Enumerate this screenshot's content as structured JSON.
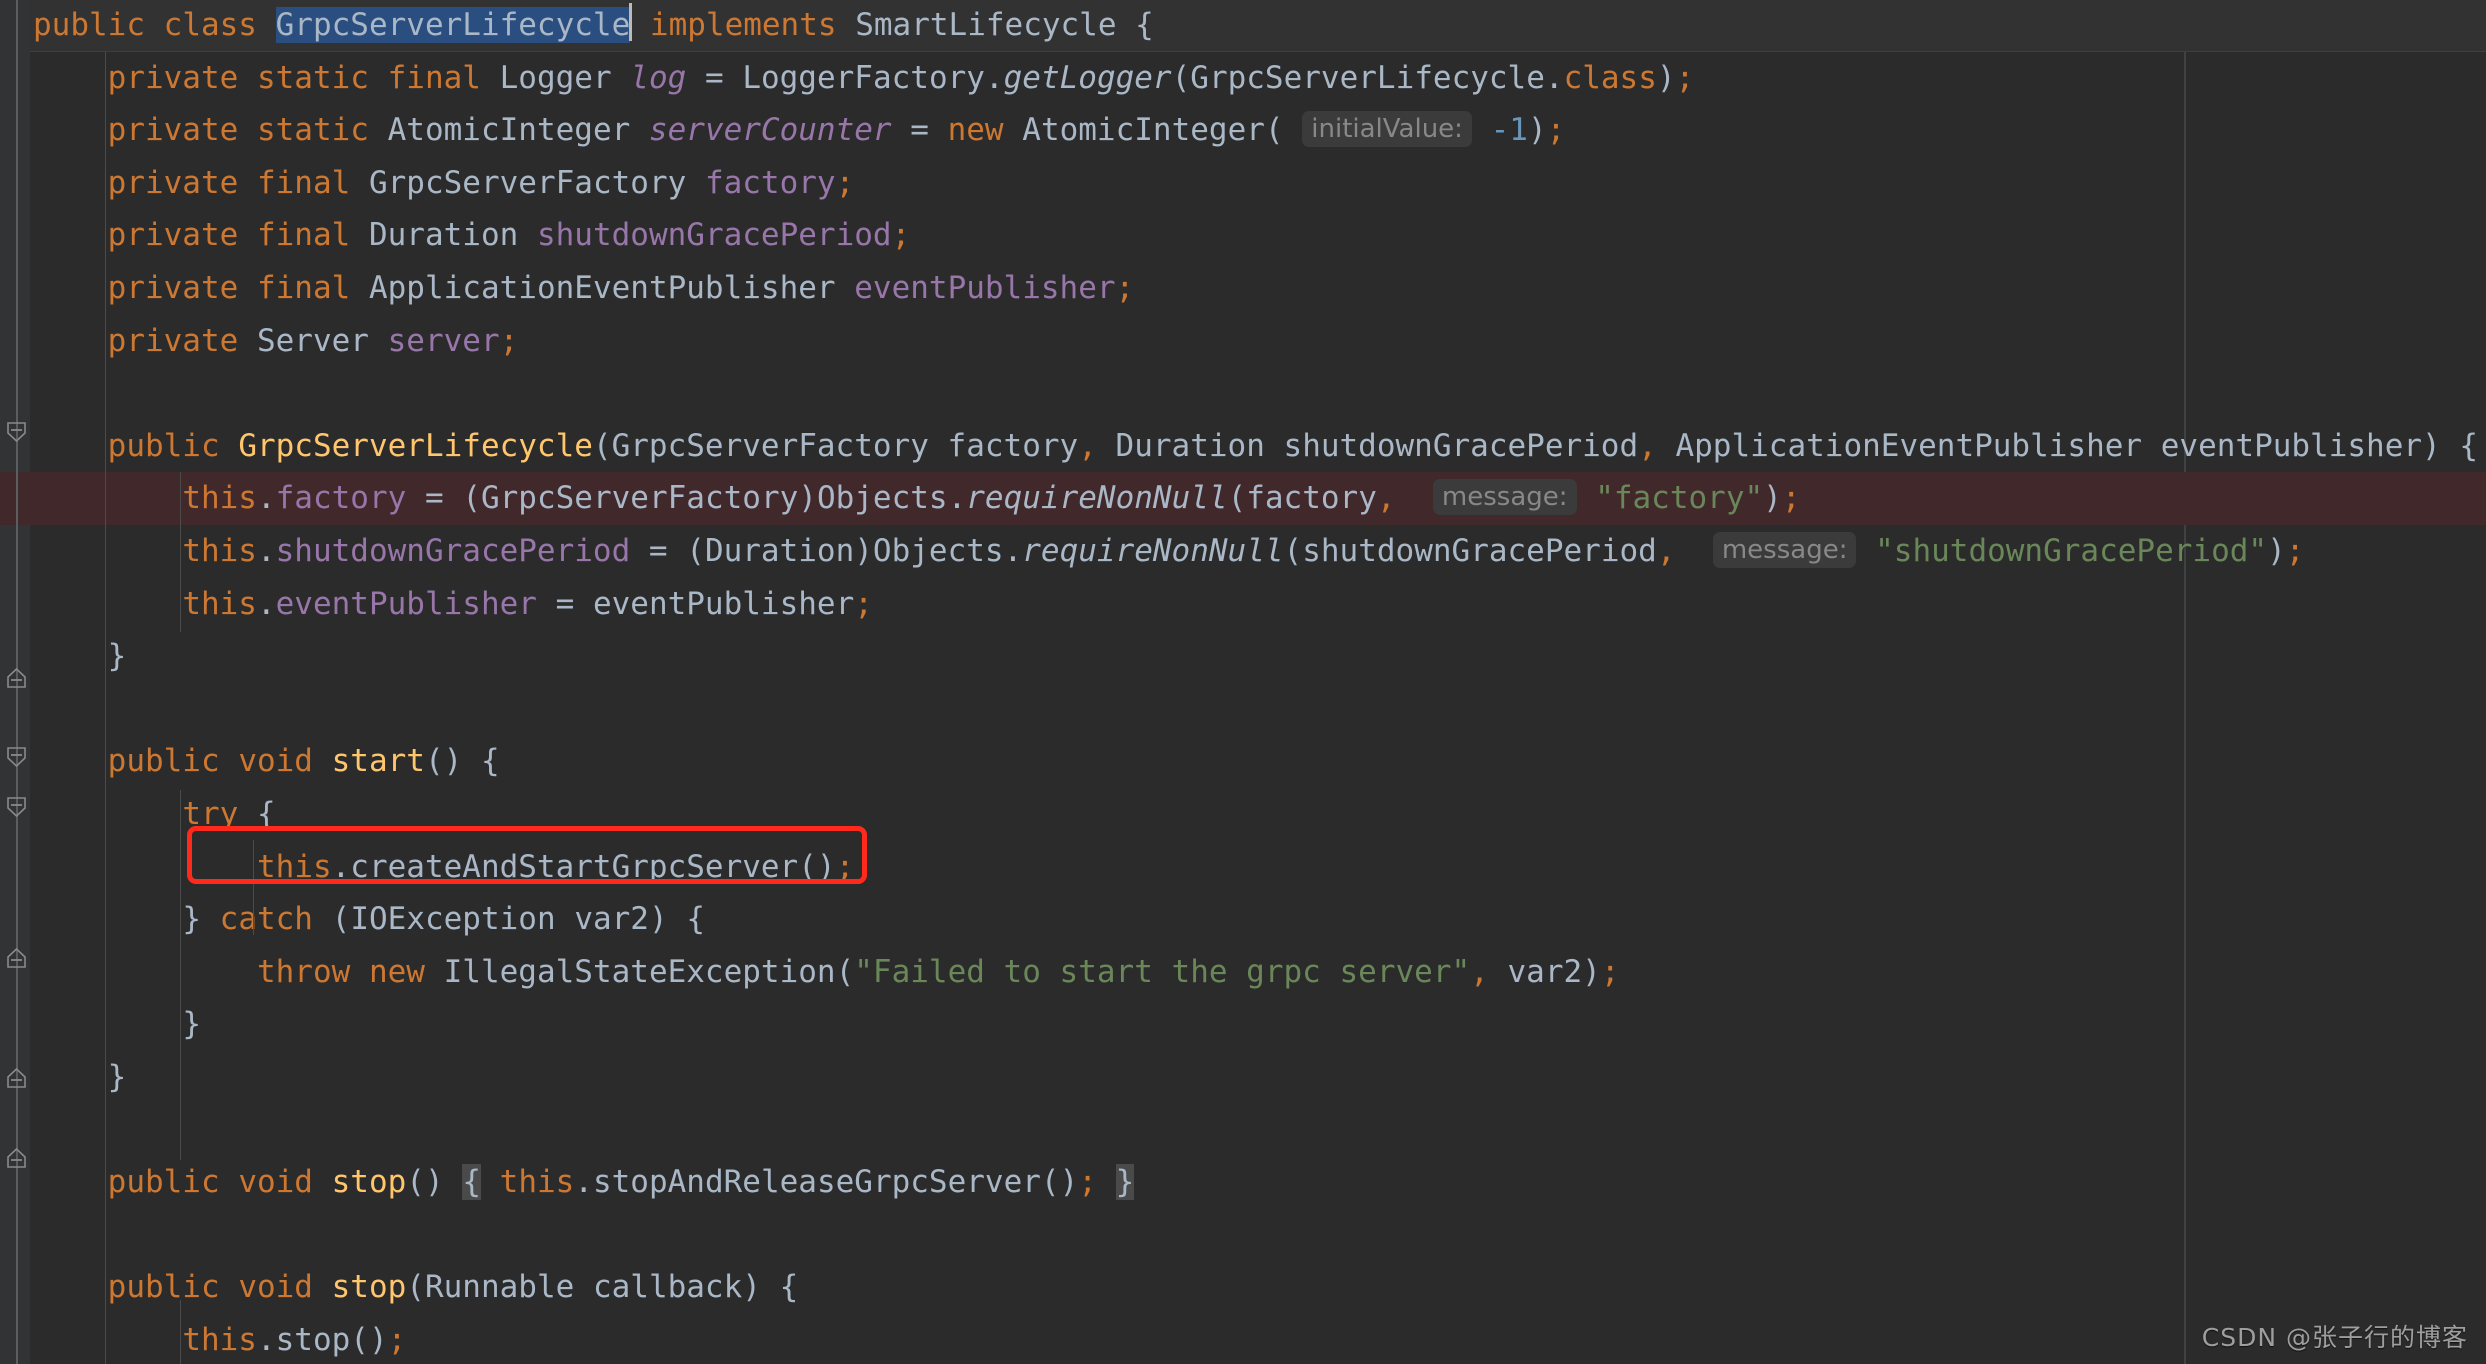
{
  "editor": {
    "theme": "Darcula",
    "language": "Java",
    "colors": {
      "background": "#2B2B2B",
      "gutter": "#313335",
      "foreground": "#A9B7C6",
      "keyword": "#CC7832",
      "string": "#6A8759",
      "number": "#6897BB",
      "field": "#9876AA",
      "method": "#FFC66D",
      "selection": "#2A4E80",
      "current_line": "#323232",
      "error_line": "#41282A",
      "inlay_hint_bg": "#3B3B3B",
      "inlay_hint_fg": "#888888",
      "annotation_box": "#FF2A1C"
    },
    "caret_line": 1,
    "selected_text": "GrpcServerLifecycle"
  },
  "code": {
    "class_name": "GrpcServerLifecycle",
    "interface_name": "SmartLifecycle",
    "lines": [
      {
        "n": 1,
        "segments": [
          {
            "t": "public ",
            "c": "kw"
          },
          {
            "t": "class ",
            "c": "kw"
          },
          {
            "t": "GrpcServerLifecycle",
            "c": "sel"
          },
          {
            "t": "|",
            "c": "caret"
          },
          {
            "t": " implements ",
            "c": "kw"
          },
          {
            "t": "SmartLifecycle",
            "c": "plain"
          },
          {
            "t": " {",
            "c": "plain"
          }
        ]
      },
      {
        "n": 2,
        "text": "    private static final Logger log = LoggerFactory.getLogger(GrpcServerLifecycle.class);"
      },
      {
        "n": 3,
        "text": "    private static AtomicInteger serverCounter = new AtomicInteger( initialValue: -1);"
      },
      {
        "n": 4,
        "text": "    private final GrpcServerFactory factory;"
      },
      {
        "n": 5,
        "text": "    private final Duration shutdownGracePeriod;"
      },
      {
        "n": 6,
        "text": "    private final ApplicationEventPublisher eventPublisher;"
      },
      {
        "n": 7,
        "text": "    private Server server;"
      },
      {
        "n": 8,
        "text": ""
      },
      {
        "n": 9,
        "text": "    public GrpcServerLifecycle(GrpcServerFactory factory, Duration shutdownGracePeriod, ApplicationEventPublisher eventPublisher) {"
      },
      {
        "n": 10,
        "text": "        this.factory = (GrpcServerFactory)Objects.requireNonNull(factory,  message: \"factory\");"
      },
      {
        "n": 11,
        "text": "        this.shutdownGracePeriod = (Duration)Objects.requireNonNull(shutdownGracePeriod,  message: \"shutdownGracePeriod\");"
      },
      {
        "n": 12,
        "text": "        this.eventPublisher = eventPublisher;"
      },
      {
        "n": 13,
        "text": "    }"
      },
      {
        "n": 14,
        "text": ""
      },
      {
        "n": 15,
        "text": "    public void start() {"
      },
      {
        "n": 16,
        "text": "        try {"
      },
      {
        "n": 17,
        "text": "            this.createAndStartGrpcServer();"
      },
      {
        "n": 18,
        "text": "        } catch (IOException var2) {"
      },
      {
        "n": 19,
        "text": "            throw new IllegalStateException(\"Failed to start the grpc server\", var2);"
      },
      {
        "n": 20,
        "text": "        }"
      },
      {
        "n": 21,
        "text": "    }"
      },
      {
        "n": 22,
        "text": ""
      },
      {
        "n": 23,
        "text": "    public void stop() { this.stopAndReleaseGrpcServer(); }"
      },
      {
        "n": 24,
        "text": ""
      },
      {
        "n": 25,
        "text": "    public void stop(Runnable callback) {"
      },
      {
        "n": 26,
        "text": "        this.stop();"
      }
    ],
    "inlay_hints": [
      {
        "label": "initialValue:",
        "line": 3
      },
      {
        "label": "message:",
        "line": 10
      },
      {
        "label": "message:",
        "line": 11
      }
    ],
    "highlighted_line": 10,
    "annotated_statement": "this.createAndStartGrpcServer();"
  },
  "watermark": {
    "text": "CSDN @张子行的博客"
  }
}
